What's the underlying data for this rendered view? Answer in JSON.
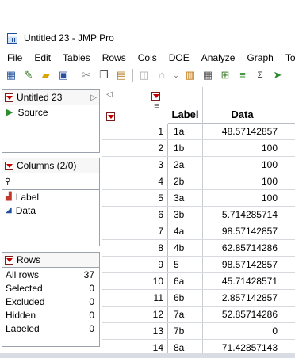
{
  "window": {
    "title": "Untitled 23 - JMP Pro"
  },
  "menu": [
    "File",
    "Edit",
    "Tables",
    "Rows",
    "Cols",
    "DOE",
    "Analyze",
    "Graph",
    "Tools"
  ],
  "toolbar": {
    "icons": [
      "table-icon",
      "new-script-icon",
      "open-icon",
      "save-icon",
      "cut-icon",
      "copy-icon",
      "paste-icon",
      "select-icon",
      "lock-icon",
      "more-icon",
      "data-grid-icon",
      "calc-icon",
      "layout-icon",
      "bar-chart-icon",
      "formula-icon",
      "arrow-icon"
    ]
  },
  "table_panel": {
    "title": "Untitled 23",
    "source": "Source"
  },
  "columns_panel": {
    "title": "Columns (2/0)",
    "search_placeholder": "",
    "columns": [
      "Label",
      "Data"
    ]
  },
  "rows_panel": {
    "title": "Rows",
    "stats": [
      {
        "label": "All rows",
        "value": "37"
      },
      {
        "label": "Selected",
        "value": "0"
      },
      {
        "label": "Excluded",
        "value": "0"
      },
      {
        "label": "Hidden",
        "value": "0"
      },
      {
        "label": "Labeled",
        "value": "0"
      }
    ]
  },
  "grid": {
    "headers": [
      "Label",
      "Data"
    ],
    "rows": [
      {
        "n": "1",
        "label": "1a",
        "data": "48.57142857"
      },
      {
        "n": "2",
        "label": "1b",
        "data": "100"
      },
      {
        "n": "3",
        "label": "2a",
        "data": "100"
      },
      {
        "n": "4",
        "label": "2b",
        "data": "100"
      },
      {
        "n": "5",
        "label": "3a",
        "data": "100"
      },
      {
        "n": "6",
        "label": "3b",
        "data": "5.714285714"
      },
      {
        "n": "7",
        "label": "4a",
        "data": "98.57142857"
      },
      {
        "n": "8",
        "label": "4b",
        "data": "62.85714286"
      },
      {
        "n": "9",
        "label": "5",
        "data": "98.57142857"
      },
      {
        "n": "10",
        "label": "6a",
        "data": "45.71428571"
      },
      {
        "n": "11",
        "label": "6b",
        "data": "2.857142857"
      },
      {
        "n": "12",
        "label": "7a",
        "data": "52.85714286"
      },
      {
        "n": "13",
        "label": "7b",
        "data": "0"
      },
      {
        "n": "14",
        "label": "8a",
        "data": "71.42857143"
      }
    ]
  }
}
